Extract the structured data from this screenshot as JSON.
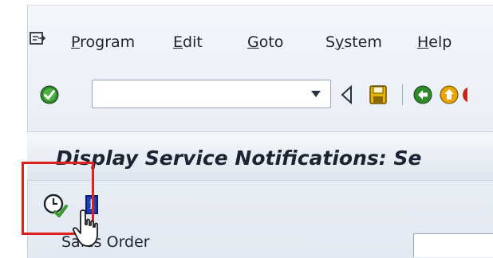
{
  "menu": {
    "items": [
      {
        "pre": "",
        "acc": "P",
        "post": "rogram"
      },
      {
        "pre": "",
        "acc": "E",
        "post": "dit"
      },
      {
        "pre": "",
        "acc": "G",
        "post": "oto"
      },
      {
        "pre": "S",
        "acc": "y",
        "post": "stem"
      },
      {
        "pre": "",
        "acc": "H",
        "post": "elp"
      }
    ]
  },
  "toolbar": {
    "command_value": ""
  },
  "title": "Display Service Notifications: Se",
  "app_toolbar": {
    "info_label": "i"
  },
  "selection": {
    "field_label": "Sales Order"
  },
  "icons": [
    "menu-icon",
    "ok-check-icon",
    "dropdown-arrow-icon",
    "back-triangle-icon",
    "save-icon",
    "back-green-icon",
    "exit-icon",
    "execute-clock-icon",
    "info-icon",
    "mouse-pointer-icon"
  ],
  "colors": {
    "highlight": "#e0201c",
    "ok_green": "#2f8a2a",
    "save_yellow": "#e8b400",
    "info_blue": "#1a3fb8"
  }
}
